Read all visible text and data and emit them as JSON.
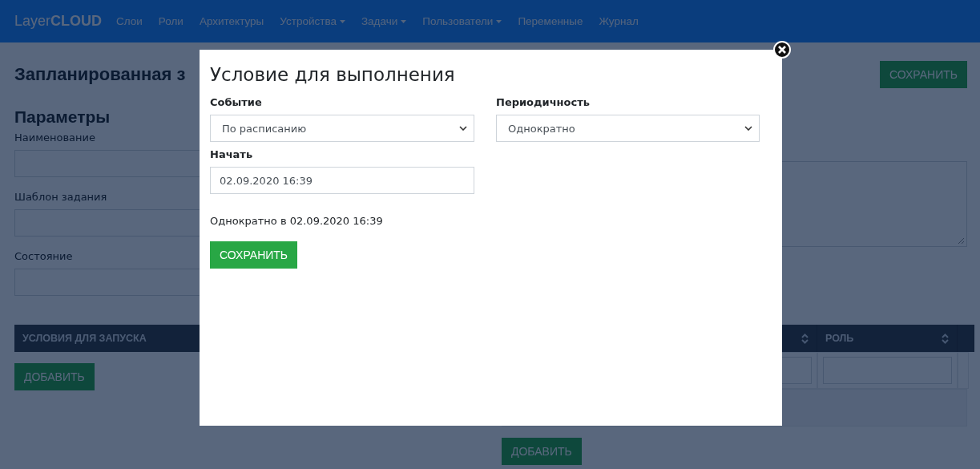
{
  "navbar": {
    "brand": "Layer**CLOUD**",
    "items": [
      {
        "label": "Слои",
        "dropdown": false
      },
      {
        "label": "Роли",
        "dropdown": false
      },
      {
        "label": "Архитектуры",
        "dropdown": false
      },
      {
        "label": "Устройства",
        "dropdown": true
      },
      {
        "label": "Задачи",
        "dropdown": true
      },
      {
        "label": "Пользователи",
        "dropdown": true
      },
      {
        "label": "Переменные",
        "dropdown": false
      },
      {
        "label": "Журнал",
        "dropdown": false
      }
    ]
  },
  "page": {
    "title": "Запланированная з",
    "save_button": "СОХРАНИТЬ",
    "section_title": "Параметры",
    "fields": [
      {
        "label": "Наименование"
      },
      {
        "label": "Шаблон задания"
      },
      {
        "label": "Состояние"
      }
    ],
    "conditions_table": {
      "columns": [
        "УСЛОВИЯ ДЛЯ ЗАПУСКА"
      ],
      "add_button": "ДОБАВИТЬ"
    },
    "roles_table": {
      "columns": [
        "РОЛЬ"
      ],
      "add_button": "ДОБАВИТЬ"
    }
  },
  "modal": {
    "title": "Условие для выполнения",
    "fields": [
      {
        "label": "Событие",
        "kind": "select",
        "value": "По расписанию"
      },
      {
        "label": "Периодичность",
        "kind": "select",
        "value": "Однократно"
      },
      {
        "label": "Начать",
        "kind": "input",
        "value": "02.09.2020 16:39"
      }
    ],
    "summary": "Однократно в 02.09.2020 16:39",
    "save_button": "СОХРАНИТЬ"
  }
}
